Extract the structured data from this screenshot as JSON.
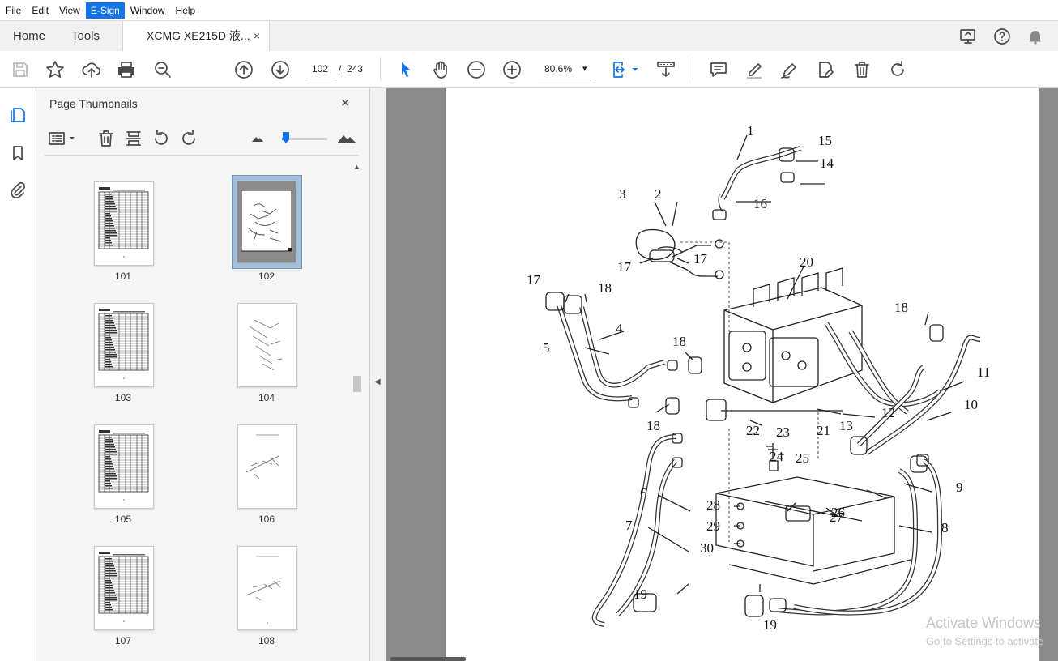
{
  "menu": {
    "items": [
      "File",
      "Edit",
      "View",
      "E-Sign",
      "Window",
      "Help"
    ],
    "active": "E-Sign"
  },
  "tabs": {
    "home": "Home",
    "tools": "Tools",
    "document": "XCMG XE215D 液...",
    "close": "×"
  },
  "toolbar": {
    "current_page": "102",
    "separator": "/",
    "total_pages": "243",
    "zoom": "80.6%",
    "zoom_caret": "▾"
  },
  "panel": {
    "title": "Page Thumbnails",
    "close": "×",
    "slider_level": 0.05,
    "thumbnails": [
      {
        "label": "101",
        "kind": "table"
      },
      {
        "label": "102",
        "kind": "drawing",
        "selected": true
      },
      {
        "label": "103",
        "kind": "table"
      },
      {
        "label": "104",
        "kind": "drawing"
      },
      {
        "label": "105",
        "kind": "table"
      },
      {
        "label": "106",
        "kind": "drawing"
      },
      {
        "label": "107",
        "kind": "table"
      },
      {
        "label": "108",
        "kind": "drawing"
      }
    ]
  },
  "document": {
    "callouts": [
      "1",
      "2",
      "3",
      "4",
      "5",
      "6",
      "7",
      "8",
      "9",
      "10",
      "11",
      "12",
      "13",
      "14",
      "15",
      "16",
      "17",
      "17",
      "17",
      "18",
      "18",
      "18",
      "18",
      "19",
      "19",
      "20",
      "21",
      "22",
      "23",
      "24",
      "25",
      "26",
      "27",
      "28",
      "29",
      "30"
    ]
  },
  "watermark": {
    "line1": "Activate Windows",
    "line2": "Go to Settings to activate"
  },
  "colors": {
    "accent": "#1473e6",
    "doc_bg": "#8a8a8a",
    "panel_bg": "#f5f5f5"
  }
}
